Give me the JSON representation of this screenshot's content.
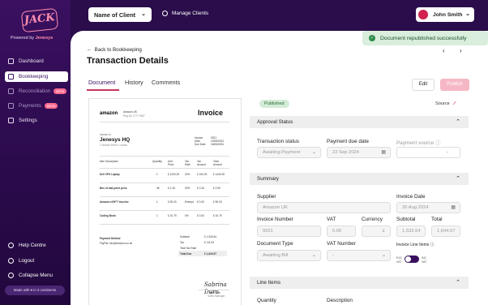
{
  "brand": {
    "logo": "JACK",
    "powered": "Powered by",
    "company": "Jenesys"
  },
  "nav": [
    {
      "label": "Dashboard",
      "icon": "grid-icon"
    },
    {
      "label": "Bookkeeping",
      "icon": "book-icon"
    },
    {
      "label": "Reconciliation",
      "icon": "swap-icon",
      "badge": "BETA"
    },
    {
      "label": "Payments",
      "icon": "card-icon",
      "badge": "BETA"
    },
    {
      "label": "Settings",
      "icon": "gear-icon"
    }
  ],
  "footer_nav": [
    {
      "label": "Help Centre"
    },
    {
      "label": "Logout"
    },
    {
      "label": "Collapse Menu"
    }
  ],
  "made_with": "Made with ♥ in 3 continents",
  "topbar": {
    "client_select": "Name of Client",
    "manage": "Manage Clients",
    "user": "John Smith"
  },
  "toast": "Document republished successfully",
  "page": {
    "back": "Back to Bookkeeping",
    "title": "Transaction Details"
  },
  "tabs": [
    "Document",
    "History",
    "Comments"
  ],
  "buttons": {
    "edit": "Edit",
    "publish": "Publish"
  },
  "invoice": {
    "vendor": "amazon",
    "vendor_name": "Amazon UK",
    "vendor_sub": "Reg No 1777 0987",
    "heading": "Invoice",
    "to_label": "Invoice to",
    "to_name": "Jenesys HQ",
    "to_sub": "1 Market Street, London",
    "meta": [
      [
        "Invoice",
        "0021"
      ],
      [
        "Date",
        "10/08/2024"
      ],
      [
        "Due Date",
        "16/08/2024"
      ]
    ],
    "columns": [
      "Item Description",
      "Quantity",
      "Unit Price",
      "Tax Rate",
      "Tax Amount",
      "Total Amount"
    ],
    "rows": [
      [
        "Dell XPS Laptop",
        "1",
        "£ 1200.00",
        "20%",
        "£ 240.00",
        "£ 1440.00"
      ],
      [
        "Box of ball-point pens",
        "36",
        "£ 2.16",
        "20%",
        "£ 0.43",
        "£ 2.59"
      ],
      [
        "Amazon eGIFT Voucher",
        "1",
        "£ 50.00",
        "Exempt",
        "£ 0.00",
        "£ 50.00"
      ],
      [
        "Coding Book",
        "1",
        "£ 10.79",
        "0%",
        "£ 0.00",
        "£ 10.79"
      ]
    ],
    "payment_method": "Payment Method",
    "paypal": "PayPal: info@amazon.co.uk",
    "totals": [
      [
        "Subtotal",
        "£ 1,532.64"
      ],
      [
        "Tax",
        "£ 111.93"
      ],
      [
        "Total Tax Rate",
        ""
      ],
      [
        "Total Due",
        "£ 1,644.57"
      ]
    ],
    "sign_name": "John Doe",
    "sign_title": "Sales Manager"
  },
  "status": {
    "pill": "Published",
    "source": "Source"
  },
  "approval": {
    "header": "Approval Status",
    "status_label": "Transaction status",
    "status_value": "Awaiting Payment",
    "due_label": "Payment due date",
    "due_value": "22 Sep 2024",
    "source_label": "Payment source",
    "source_value": "-"
  },
  "summary": {
    "header": "Summary",
    "supplier_label": "Supplier",
    "supplier_value": "Amazon UK",
    "date_label": "Invoice Date",
    "date_value": "30 Aug 2024",
    "num_label": "Invoice Number",
    "num_value": "0021",
    "vat_label": "VAT",
    "vat_value": "0.00",
    "cur_label": "Currency",
    "cur_value": "£",
    "sub_label": "Subtotal",
    "sub_value": "1,532.64",
    "total_label": "Total",
    "total_value": "1,644.57",
    "type_label": "Document Type",
    "type_value": "Awaiting Bill",
    "vatnum_label": "VAT Number",
    "vatnum_value": "-",
    "lines_label": "Invoice Line Items",
    "tog_left": "EXC VAT",
    "tog_right": "INC VAT"
  },
  "line_items": {
    "header": "Line Items",
    "qty": "Quantity",
    "desc": "Description"
  }
}
